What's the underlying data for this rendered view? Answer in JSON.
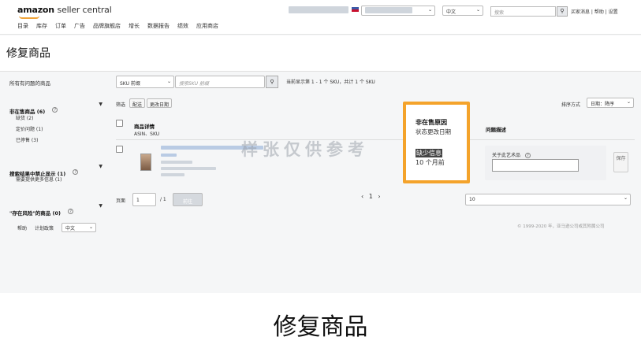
{
  "app": {
    "logo_brand": "amazon",
    "logo_product": "seller central"
  },
  "nav": {
    "items": [
      "目录",
      "库存",
      "订单",
      "广告",
      "品牌旗舰店",
      "增长",
      "数据报告",
      "绩效",
      "应用商店"
    ]
  },
  "header": {
    "language": "中文",
    "search_placeholder": "搜索",
    "links": "买家消息 | 帮助 | 设置"
  },
  "page": {
    "title": "修复商品"
  },
  "sidebar": {
    "all_label": "所有有问题的商品",
    "sections": [
      {
        "title": "非在售商品 (6)",
        "items": [
          "缺货 (2)",
          "定价问题 (1)",
          "已停售 (3)"
        ]
      },
      {
        "title": "搜索结果中禁止显示 (1)",
        "items": [
          "需要提供更多信息 (1)"
        ]
      },
      {
        "title": "\"存在风险\"的商品 (0)",
        "items": []
      }
    ]
  },
  "search": {
    "field_select": "SKU 前缀",
    "placeholder": "搜索SKU 前缀",
    "result_text": "当前显示第 1 - 1 个 SKU，共计 1 个 SKU"
  },
  "filters": {
    "label": "筛选",
    "buttons": [
      "配送",
      "更改日期"
    ],
    "sort_label": "排序方式",
    "sort_value": "日期：降序"
  },
  "table": {
    "col_details": "商品详情",
    "col_details_sub": "ASIN、SKU",
    "col_reason": "非在售原因",
    "col_reason_sub": "状态更改日期",
    "col_problem": "问题描述",
    "row": {
      "reason_badge": "缺少信息",
      "reason_time": "10 个月前",
      "art_label": "关于此艺术品",
      "save_label": "保存"
    }
  },
  "pagination": {
    "page_label": "页面",
    "page_value": "1",
    "total_pages": "/ 1",
    "go_label": "前往",
    "nav": "‹ 1 ›",
    "per_page": "10"
  },
  "footer": {
    "help": "帮助",
    "policy": "计划政策",
    "language": "中文",
    "copyright": "© 1999-2020 年，亚马逊公司或其附属公司"
  },
  "watermark": "样张仅供参考",
  "caption": "修复商品",
  "colors": {
    "highlight": "#f4a32b",
    "logo_smile": "#f0a43a"
  }
}
